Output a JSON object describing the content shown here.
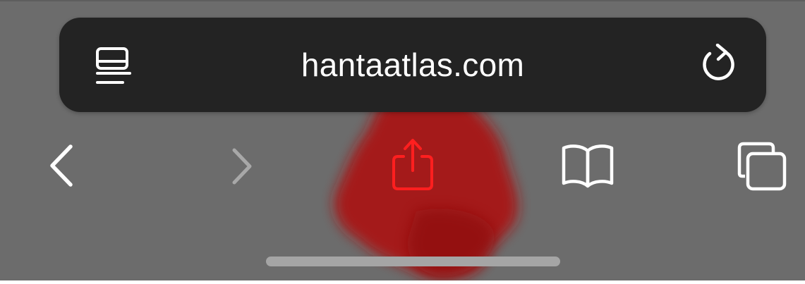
{
  "address_bar": {
    "url": "hantaatlas.com",
    "left_icon": "reader-view-icon",
    "right_icon": "reload-icon"
  },
  "toolbar": {
    "buttons": [
      {
        "name": "back",
        "icon": "chevron-left-icon",
        "enabled": true
      },
      {
        "name": "forward",
        "icon": "chevron-right-icon",
        "enabled": false
      },
      {
        "name": "share",
        "icon": "share-icon",
        "highlighted": true
      },
      {
        "name": "bookmarks",
        "icon": "book-icon",
        "enabled": true
      },
      {
        "name": "tabs",
        "icon": "tabs-icon",
        "enabled": true
      }
    ]
  },
  "colors": {
    "toolbar_bg": "#6c6c6c",
    "address_bg": "#232323",
    "icon_white": "#ffffff",
    "disabled_gray": "#a8a8a8",
    "share_red": "#ff1f1f",
    "smudge_red": "#a81414"
  }
}
